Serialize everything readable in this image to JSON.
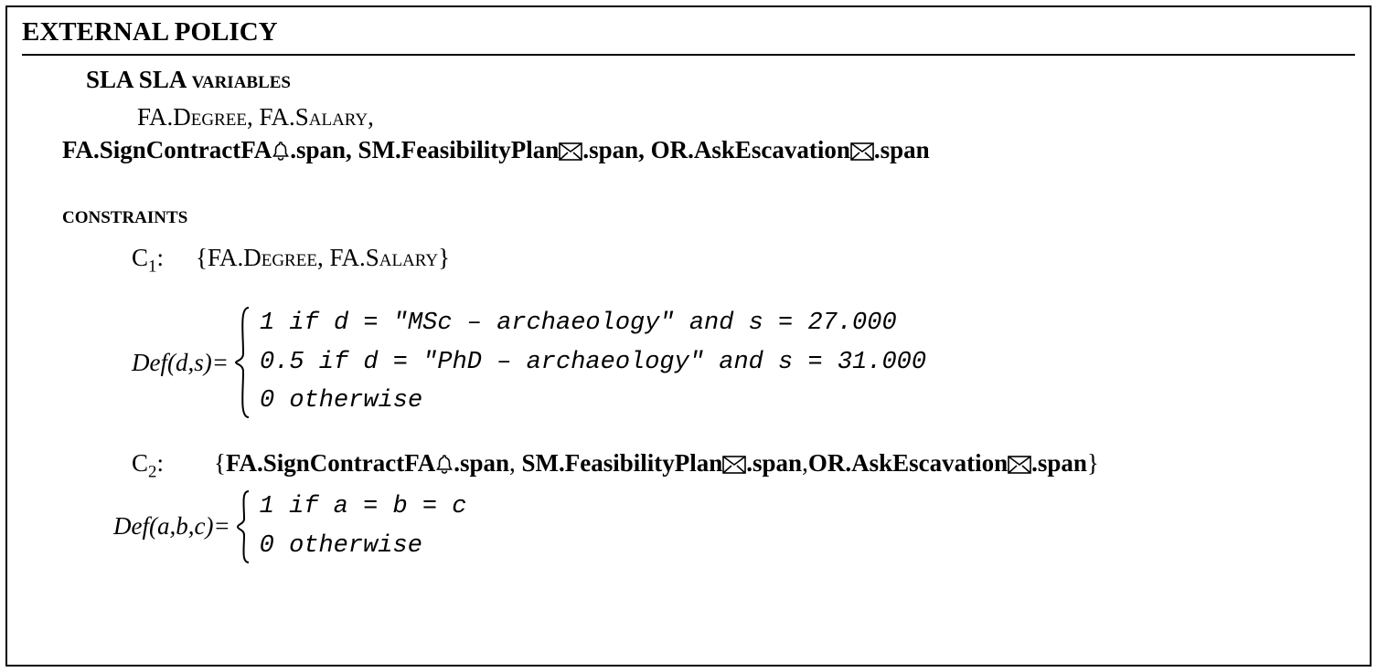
{
  "title": "EXTERNAL POLICY",
  "sla_heading": "SLA variables",
  "sla_line1_a": "FA.Degree",
  "sla_line1_b": "FA.Salary",
  "sla_line2_a_pre": "FA.",
  "sla_line2_a_mid": "SignContractFA",
  "sla_line2_a_post": ".span",
  "sla_line2_b_pre": "SM.",
  "sla_line2_b_mid": "FeasibilityPlan",
  "sla_line2_b_post": ".span",
  "sla_line2_c_pre": "OR.",
  "sla_line2_c_mid": "AskEscavation",
  "sla_line2_c_post": ".span",
  "constraints_heading": "constraints",
  "c1": {
    "label": "C",
    "sub": "1",
    "colon": ":",
    "set_open": "{",
    "a": "FA.Degree",
    "sep": ", ",
    "b": "FA.Salary",
    "set_close": "}",
    "def_lhs": "Def(d,s)=",
    "case1": "1 if d = \"MSc – archaeology\" and s = 27.000",
    "case2": "0.5 if d = \"PhD – archaeology\" and s = 31.000",
    "case3": "0 otherwise"
  },
  "c2": {
    "label": "C",
    "sub": "2",
    "colon": ":",
    "set_open": "{",
    "a_pre": "FA.",
    "a_mid": "SignContractFA",
    "a_post": ".span",
    "sep1": ", ",
    "b_pre": "SM.",
    "b_mid": "FeasibilityPlan",
    "b_post": ".span",
    "sep2": ",",
    "c_pre": "OR.",
    "c_mid": "AskEscavation",
    "c_post": ".span",
    "set_close": "}",
    "def_lhs": "Def(a,b,c)=",
    "case1": "1 if a = b = c",
    "case2": "0 otherwise"
  }
}
